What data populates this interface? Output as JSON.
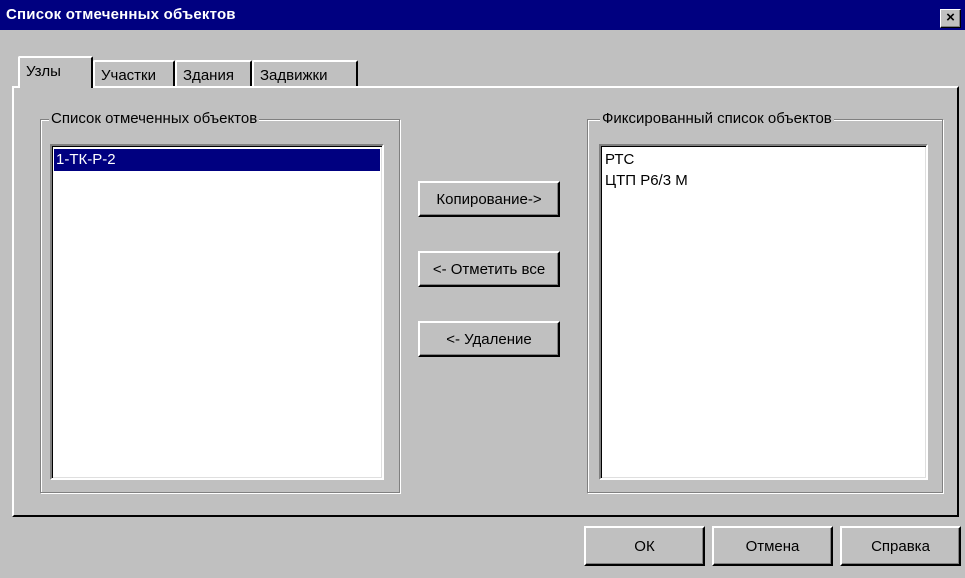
{
  "window": {
    "title": "Список отмеченных объектов",
    "close_glyph": "×"
  },
  "tabs": [
    {
      "label": "Узлы",
      "active": true
    },
    {
      "label": "Участки",
      "active": false
    },
    {
      "label": "Здания",
      "active": false
    },
    {
      "label": "Задвижки",
      "active": false
    }
  ],
  "left_group": {
    "label": "Список отмеченных объектов",
    "items": [
      {
        "text": "1-ТК-Р-2",
        "selected": true
      }
    ]
  },
  "right_group": {
    "label": "Фиксированный список объектов",
    "items": [
      {
        "text": "РТС",
        "selected": false
      },
      {
        "text": "ЦТП Р6/3 М",
        "selected": false
      }
    ]
  },
  "middle_buttons": {
    "copy": "Копирование->",
    "mark_all": "<- Отметить все",
    "delete": "<- Удаление"
  },
  "footer_buttons": {
    "ok": "ОК",
    "cancel": "Отмена",
    "help": "Справка"
  },
  "colors": {
    "titlebar": "#000080",
    "face": "#c0c0c0",
    "selection": "#000080"
  }
}
